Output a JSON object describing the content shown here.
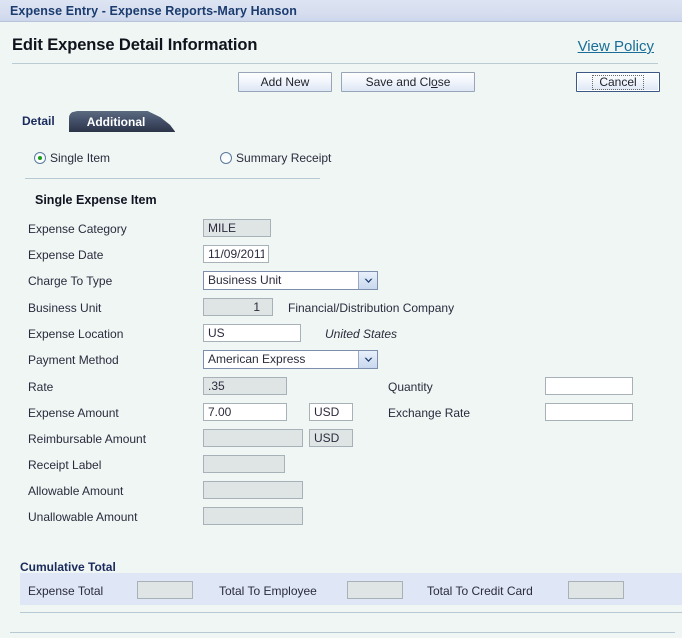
{
  "window": {
    "title": "Expense Entry - Expense Reports-Mary Hanson"
  },
  "header": {
    "page_title": "Edit Expense Detail Information",
    "view_policy_link": "View Policy"
  },
  "toolbar": {
    "add_new_label": "Add New",
    "save_and_close_label_pre": "Save and Cl",
    "save_and_close_label_accel": "o",
    "save_and_close_label_post": "se",
    "cancel_label": "Cancel"
  },
  "tabs": [
    {
      "label": "Detail",
      "active": false
    },
    {
      "label": "Additional",
      "active": true
    }
  ],
  "entry_type": {
    "single_item_label": "Single Item",
    "single_item_selected": true,
    "summary_receipt_label": "Summary Receipt",
    "summary_receipt_selected": false
  },
  "section": {
    "title": "Single Expense Item"
  },
  "fields": {
    "expense_category": {
      "label": "Expense Category",
      "value": "MILE"
    },
    "expense_date": {
      "label": "Expense Date",
      "value": "11/09/2011"
    },
    "charge_to_type": {
      "label": "Charge To Type",
      "value": "Business Unit"
    },
    "business_unit": {
      "label": "Business Unit",
      "value": "1",
      "description": "Financial/Distribution Company"
    },
    "expense_location": {
      "label": "Expense Location",
      "value": "US",
      "description": "United States"
    },
    "payment_method": {
      "label": "Payment Method",
      "value": "American Express"
    },
    "rate": {
      "label": "Rate",
      "value": ".35"
    },
    "quantity": {
      "label": "Quantity",
      "value": ""
    },
    "expense_amount": {
      "label": "Expense Amount",
      "value": "7.00",
      "currency": "USD"
    },
    "exchange_rate": {
      "label": "Exchange Rate",
      "value": ""
    },
    "reimbursable_amount": {
      "label": "Reimbursable Amount",
      "value": "",
      "currency": "USD"
    },
    "receipt_label": {
      "label": "Receipt Label",
      "value": ""
    },
    "allowable_amount": {
      "label": "Allowable Amount",
      "value": ""
    },
    "unallowable_amount": {
      "label": "Unallowable Amount",
      "value": ""
    }
  },
  "cumulative_total": {
    "title": "Cumulative Total",
    "expense_total": {
      "label": "Expense Total",
      "value": ""
    },
    "total_to_employee": {
      "label": "Total To Employee",
      "value": ""
    },
    "total_to_credit_card": {
      "label": "Total To Credit Card",
      "value": ""
    }
  },
  "colors": {
    "titlebar": "#d6deef",
    "body": "#eff6f4",
    "link": "#1a6d96",
    "tab_active": "#2c3447",
    "band": "#dfe6f5",
    "radio_dot": "#16a016",
    "disabled_field": "#dfe5e5"
  }
}
